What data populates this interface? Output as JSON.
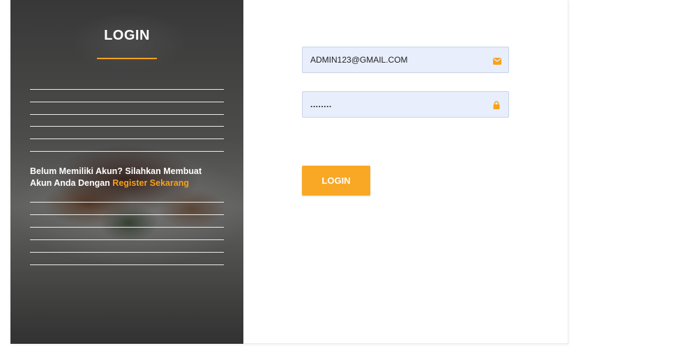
{
  "left_panel": {
    "title": "LOGIN",
    "register_prompt": "Belum Memiliki Akun? Silahkan Membuat Akun Anda Dengan ",
    "register_link": "Register Sekarang"
  },
  "form": {
    "email": {
      "value": "ADMIN123@GMAIL.COM",
      "icon": "envelope-icon"
    },
    "password": {
      "value": "........",
      "icon": "lock-icon"
    },
    "login_button": "LOGIN"
  },
  "colors": {
    "accent": "#f7a21b",
    "input_bg": "#e8eefb",
    "panel_overlay": "#2a2a2a"
  }
}
